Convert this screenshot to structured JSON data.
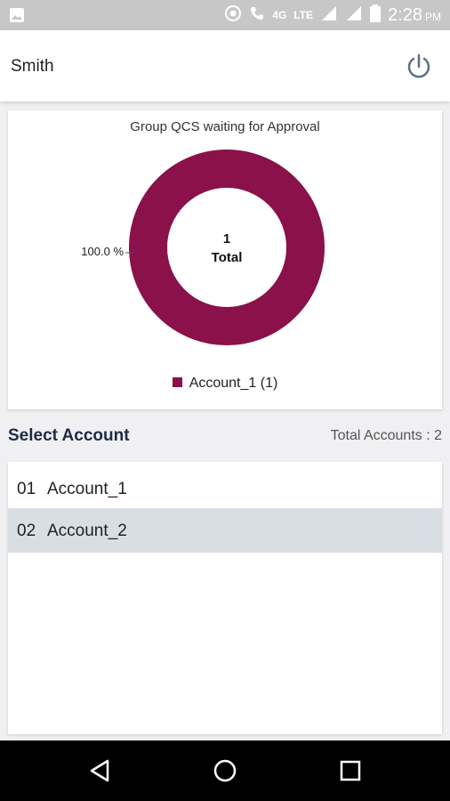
{
  "status_bar": {
    "network_label": "LTE",
    "lte_badge": "4G",
    "time": "2:28",
    "ampm": "PM"
  },
  "header": {
    "user_name": "Smith",
    "power_icon": "power-icon"
  },
  "chart_card": {
    "title": "Group QCS waiting for Approval",
    "center_count": "1",
    "center_label": "Total",
    "slice_percent_label": "100.0 %",
    "legend_label": "Account_1 (1)"
  },
  "chart_data": {
    "type": "pie",
    "title": "Group QCS waiting for Approval",
    "categories": [
      "Account_1 (1)"
    ],
    "values": [
      1
    ],
    "percent_labels": [
      "100.0 %"
    ],
    "center_text": [
      "1",
      "Total"
    ],
    "donut": true,
    "colors": [
      "#8a1149"
    ],
    "legend_position": "bottom"
  },
  "accounts_section": {
    "title": "Select Account",
    "total_label": "Total Accounts : 2",
    "rows": [
      {
        "num": "01",
        "name": "Account_1",
        "selected": false
      },
      {
        "num": "02",
        "name": "Account_2",
        "selected": true
      }
    ]
  },
  "nav_bar": {
    "back_icon": "back-icon",
    "home_icon": "home-icon",
    "recents_icon": "recents-icon"
  },
  "colors": {
    "accent": "#8a1149",
    "header_bg": "#ffffff",
    "selected_row": "#d9dee3",
    "status_bar": "#c7c7c7"
  }
}
